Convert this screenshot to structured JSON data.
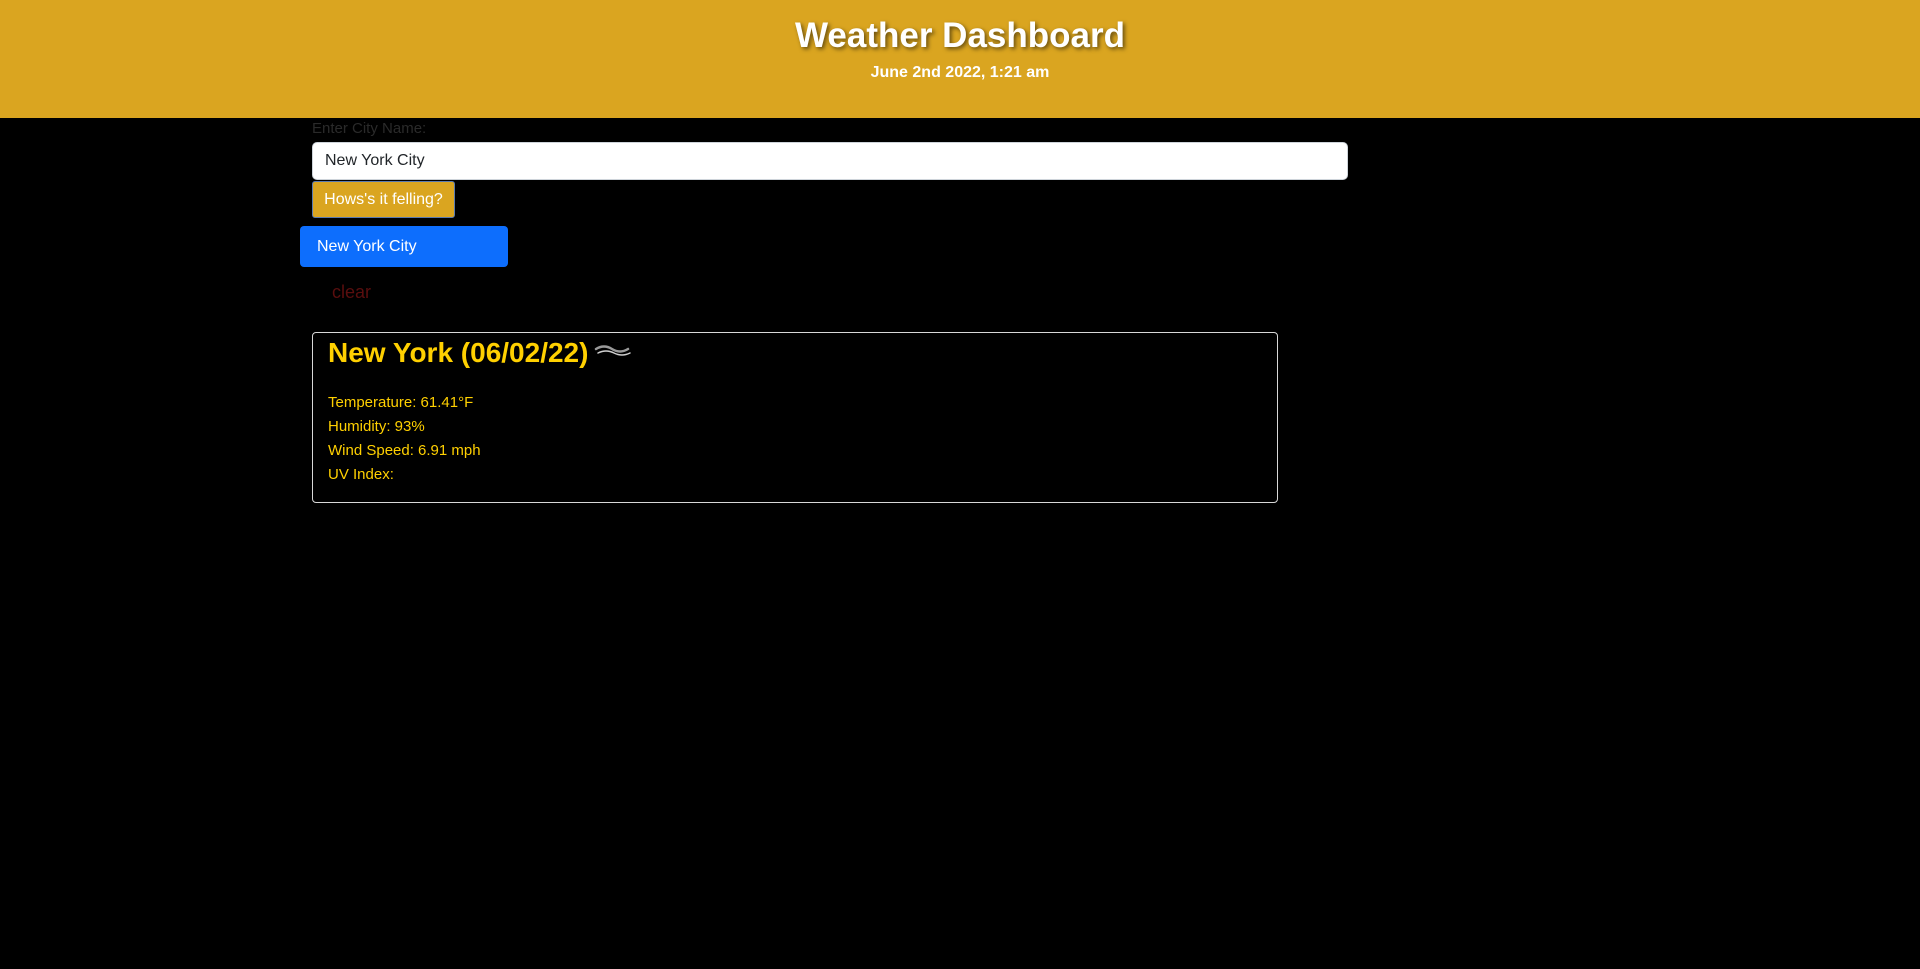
{
  "header": {
    "title": "Weather Dashboard",
    "date": "June 2nd 2022, 1:21 am"
  },
  "search": {
    "label": "Enter City Name:",
    "value": "New York City",
    "button_label": "Hows's it felling?"
  },
  "history": {
    "items": [
      {
        "label": "New York City"
      }
    ],
    "clear_label": "clear"
  },
  "current_weather": {
    "title": "New York (06/02/22)",
    "icon": "mist-icon",
    "temperature": "Temperature: 61.41°F",
    "humidity": "Humidity: 93%",
    "wind_speed": "Wind Speed: 6.91 mph",
    "uv_index": "UV Index:"
  },
  "colors": {
    "header_bg": "#daa520",
    "accent_text": "#ffd000",
    "history_bg": "#0d6efd",
    "clear_text": "#5a0e0e"
  }
}
